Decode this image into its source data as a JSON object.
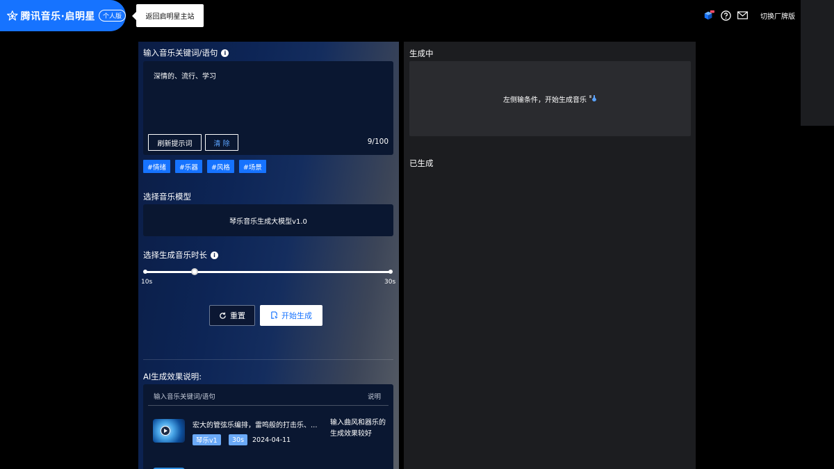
{
  "header": {
    "brand_name": "腾讯音乐·启明星",
    "brand_badge": "个人版",
    "back_link": "返回启明星主站",
    "switch_link": "切换厂牌版"
  },
  "input_section": {
    "title": "输入音乐关键词/语句",
    "prompt_text": "深情的、流行、学习",
    "refresh_label": "刷新提示词",
    "clear_label": "清 除",
    "char_count": "9/100",
    "tags": [
      "#情绪",
      "#乐器",
      "#风格",
      "#场景"
    ]
  },
  "model_section": {
    "title": "选择音乐模型",
    "selected_model": "琴乐音乐生成大模型v1.0"
  },
  "duration_section": {
    "title": "选择生成音乐时长",
    "min_label": "10s",
    "max_label": "30s",
    "min": 10,
    "max": 30,
    "value": 14
  },
  "actions": {
    "reset_label": "重置",
    "start_label": "开始生成"
  },
  "effects_section": {
    "title": "AI生成效果说明:",
    "col_keywords": "输入音乐关键词/语句",
    "col_description": "说明",
    "rows": [
      {
        "text": "宏大的管弦乐编排，雷鸣般的打击乐、...",
        "model_badge": "琴乐v1",
        "duration_badge": "30s",
        "date": "2024-04-11",
        "description": "输入曲风和器乐的生成效果较好"
      }
    ]
  },
  "generating": {
    "title": "生成中",
    "hint": "左侧输条件，开始生成音乐"
  },
  "generated": {
    "title": "已生成"
  }
}
